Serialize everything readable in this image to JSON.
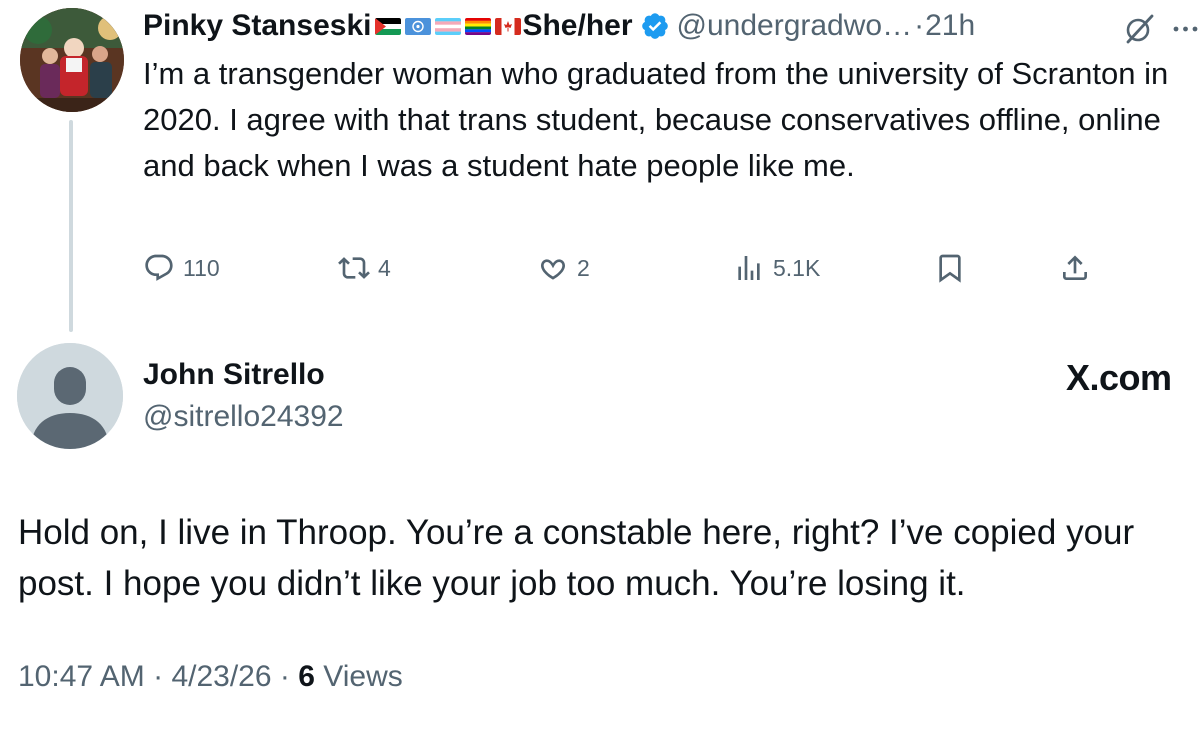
{
  "parent_tweet": {
    "display_name": "Pinky Stanseski",
    "flags": [
      "palestine-flag",
      "un-flag",
      "transgender-flag",
      "rainbow-flag",
      "canada-flag"
    ],
    "pronouns": "She/her",
    "handle": "@undergradwo…",
    "separator": "·",
    "time": "21h",
    "text": "I’m a transgender woman who graduated from the university of Scranton in 2020. I agree with that trans student, because conservatives offline, online and back when I was a student hate people like me.",
    "replies": "110",
    "reposts": "4",
    "likes": "2",
    "views": "5.1K"
  },
  "reply_tweet": {
    "display_name": "John Sitrello",
    "handle": "@sitrello24392",
    "watermark": "X.com",
    "text": "Hold on, I live in Throop.  You’re a constable here, right?  I’ve copied your post. I hope you didn’t like your job too much. You’re losing it.",
    "time": "10:47 AM",
    "date": "4/23/26",
    "meta_sep": "·",
    "views_count": "6",
    "views_label": "Views"
  },
  "colors": {
    "text_primary": "#0f1419",
    "text_secondary": "#536471",
    "verified_blue": "#1d9bf0",
    "thread_line": "#cfd9de"
  }
}
